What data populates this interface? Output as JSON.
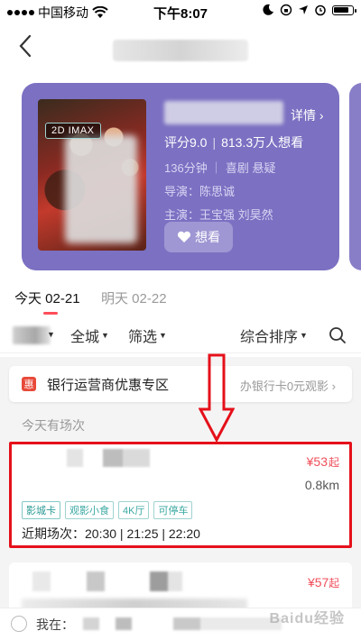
{
  "status_bar": {
    "carrier": "中国移动",
    "time": "下午8:07",
    "icons": [
      "signal-icon",
      "wifi-icon",
      "moon-icon",
      "lock-rotation-icon",
      "location-icon",
      "alarm-icon",
      "battery-icon"
    ]
  },
  "nav": {
    "back_icon": "chevron-left-icon"
  },
  "movie": {
    "format_tag": "2D IMAX",
    "detail_label": "详情 ›",
    "rating_label": "评分9.0",
    "want_count": "813.3万人想看",
    "meta": "136分钟 ｜ 喜剧 悬疑",
    "director": "导演：陈思诚",
    "cast": "主演：王宝强 刘昊然",
    "want_button": "想看",
    "accent_color": "#7b70c2"
  },
  "date_tabs": [
    {
      "label": "今天 02-21",
      "active": true
    },
    {
      "label": "明天 02-22",
      "active": false
    }
  ],
  "filters": {
    "city": "全城",
    "filter": "筛选",
    "sort": "综合排序"
  },
  "bank_banner": {
    "icon_text": "惠",
    "title": "银行运营商优惠专区",
    "subtitle": "办银行卡0元观影 ›"
  },
  "today_label": "今天有场次",
  "cinema": {
    "price": "¥53",
    "price_suffix": "起",
    "distance": "0.8km",
    "tags": [
      "影城卡",
      "观影小食",
      "4K厅",
      "可停车"
    ],
    "recent_label": "近期场次：",
    "recent_times": "20:30 | 21:25 | 22:20"
  },
  "cinema2": {
    "price": "¥57",
    "price_suffix": "起"
  },
  "location_bar": {
    "label": "我在："
  },
  "watermark": "Baidu经验"
}
